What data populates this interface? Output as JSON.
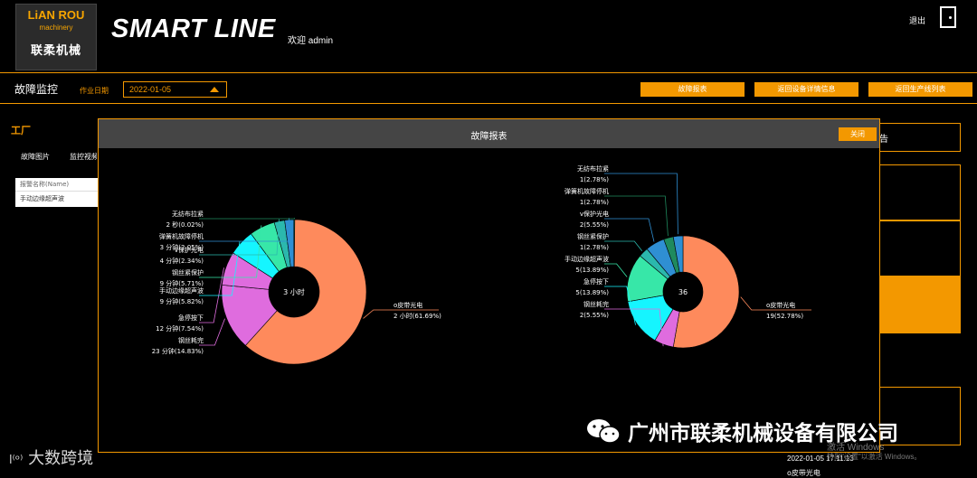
{
  "header": {
    "logo_line1": "LiAN ROU",
    "logo_line2": "machinery",
    "logo_line3": "联柔机械",
    "brand": "SMART LINE",
    "welcome": "欢迎 admin",
    "logout": "退出"
  },
  "toolbar": {
    "page_tab": "故障监控",
    "work_date_label": "作业日期",
    "work_date": "2022-01-05",
    "buttons": [
      "故障报表",
      "返回设备详情信息",
      "返回生产线列表"
    ]
  },
  "left_panel": {
    "factory": "工厂",
    "tabs": [
      "故障图片",
      "监控视频"
    ],
    "table_header": "报警名称(Name)",
    "table_row": "手动边缘超声波"
  },
  "right_panel": {
    "heading_fragment": "告",
    "time": "2022-01-05 17:11:13",
    "item": "o皮带光电"
  },
  "modal": {
    "title": "故障报表",
    "close_label": "关闭"
  },
  "colors": {
    "accent": "#f39800",
    "panel_gray": "#454545",
    "slice_salmon": "#fe8a5c",
    "slice_violet": "#df6cde",
    "slice_cyan": "#15f5ff",
    "slice_green": "#37e7a8",
    "slice_teal": "#2bb8ad",
    "slice_blue": "#2f8fd3",
    "slice_forest": "#1f8a5e"
  },
  "chart_data": [
    {
      "type": "pie",
      "variant": "donut",
      "center_label": "3 小时",
      "slices": [
        {
          "name": "o皮带光电",
          "value_label": "2 小时(61.69%)",
          "percent": 61.69,
          "color": "#fe8a5c"
        },
        {
          "name": "钢丝耗完",
          "value_label": "23 分钟(14.83%)",
          "percent": 14.83,
          "color": "#df6cde"
        },
        {
          "name": "急停按下",
          "value_label": "12 分钟(7.54%)",
          "percent": 7.54,
          "color": "#df6cde"
        },
        {
          "name": "手动边缘超声波",
          "value_label": "9 分钟(5.82%)",
          "percent": 5.82,
          "color": "#15f5ff"
        },
        {
          "name": "钢丝紧保护",
          "value_label": "9 分钟(5.71%)",
          "percent": 5.71,
          "color": "#37e7a8"
        },
        {
          "name": "v保护光电",
          "value_label": "4 分钟(2.34%)",
          "percent": 2.34,
          "color": "#2bb8ad"
        },
        {
          "name": "弹簧机故障停机",
          "value_label": "3 分钟(2.05%)",
          "percent": 2.05,
          "color": "#2f8fd3"
        },
        {
          "name": "无纺布拉紧",
          "value_label": "2 秒(0.02%)",
          "percent": 0.02,
          "color": "#1f8a5e"
        }
      ]
    },
    {
      "type": "pie",
      "variant": "donut",
      "center_label": "36",
      "slices": [
        {
          "name": "o皮带光电",
          "value_label": "19(52.78%)",
          "percent": 52.78,
          "color": "#fe8a5c"
        },
        {
          "name": "钢丝耗完",
          "value_label": "2(5.55%)",
          "percent": 5.55,
          "color": "#df6cde"
        },
        {
          "name": "急停按下",
          "value_label": "5(13.89%)",
          "percent": 13.89,
          "color": "#15f5ff"
        },
        {
          "name": "手动边缘超声波",
          "value_label": "5(13.89%)",
          "percent": 13.89,
          "color": "#37e7a8"
        },
        {
          "name": "钢丝紧保护",
          "value_label": "1(2.78%)",
          "percent": 2.78,
          "color": "#2bb8ad"
        },
        {
          "name": "v保护光电",
          "value_label": "2(5.55%)",
          "percent": 5.55,
          "color": "#2f8fd3"
        },
        {
          "name": "弹簧机故障停机",
          "value_label": "1(2.78%)",
          "percent": 2.78,
          "color": "#1f8a5e"
        },
        {
          "name": "无纺布拉紧",
          "value_label": "1(2.78%)",
          "percent": 2.78,
          "color": "#2f8fd3"
        }
      ]
    }
  ],
  "overlay": {
    "watermark": "广州市联柔机械设备有限公司",
    "corner_logo": "大数跨境",
    "activate_1": "激活 Windows",
    "activate_2": "转到\"设置\"以激活 Windows。"
  }
}
